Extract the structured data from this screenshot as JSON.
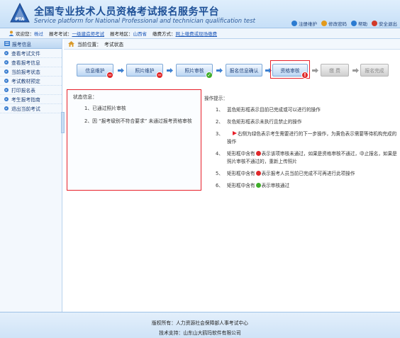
{
  "header": {
    "title": "全国专业技术人员资格考试报名服务平台",
    "subtitle": "Service platform for National Professional and technician qualification test",
    "logo_text": "PTA",
    "links": [
      {
        "label": "注册维护",
        "icon": "register-icon",
        "color": "#2b7bd1"
      },
      {
        "label": "修改密码",
        "icon": "key-icon",
        "color": "#e39a1c"
      },
      {
        "label": "帮助",
        "icon": "help-icon",
        "color": "#2b7bd1"
      },
      {
        "label": "安全退出",
        "icon": "exit-icon",
        "color": "#d23a2a"
      }
    ]
  },
  "infobar": {
    "welcome_label": "欢迎您：",
    "welcome_value": "杨过",
    "exam_label": "报考考试：",
    "exam_value": "一级建造师考试",
    "region_label": "报考地区：",
    "region_value": "山西省",
    "fee_label": "缴费方式：",
    "fee_value": "网上缴费或现场缴费"
  },
  "sidebar": {
    "header": "报考信息",
    "items": [
      {
        "label": "查看考试文件"
      },
      {
        "label": "查看报考信息"
      },
      {
        "label": "当前报考状态"
      },
      {
        "label": "考试教材预定"
      },
      {
        "label": "打印报名表"
      },
      {
        "label": "考生报考指南"
      },
      {
        "label": "退出当前考试"
      }
    ]
  },
  "breadcrumb": {
    "label": "当前位置：",
    "value": "考试状态"
  },
  "steps": [
    {
      "label": "信息维护",
      "state": "fail"
    },
    {
      "label": "照片维护",
      "state": "fail"
    },
    {
      "label": "照片审核",
      "state": "pass"
    },
    {
      "label": "报名信息确认",
      "state": "none"
    },
    {
      "label": "资格审核",
      "state": "warn"
    },
    {
      "label": "缴 费",
      "state": "disabled"
    },
    {
      "label": "报名完成",
      "state": "disabled"
    }
  ],
  "status": {
    "title": "状态信息：",
    "lines": [
      "1、已通过照片审核",
      "2、因 “报考级别不符合要求” 未通过报考资格审核"
    ]
  },
  "tips": {
    "title": "操作提示：",
    "items": [
      {
        "num": "1、",
        "text": "蓝色矩形框表示目前已完成或可以进行的操作"
      },
      {
        "num": "2、",
        "text": "灰色矩形框表示未执行且禁止的操作"
      },
      {
        "num": "3、",
        "text": "右侧为绿色表示考生需要进行的下一步操作，为黄色表示需要等待机构完成的操作"
      },
      {
        "num": "4、",
        "text_a": "矩形框中含有",
        "text_b": "表示该项审核未通过，如果是资格审核不通过，中止报名，如果是照片审核不通过的，重新上传照片"
      },
      {
        "num": "5、",
        "text_a": "矩形框中含有",
        "text_b": "表示报考人员当前已完成不可再进行此项操作"
      },
      {
        "num": "6、",
        "text_a": "矩形框中含有",
        "text_b": "表示审核通过"
      }
    ]
  },
  "footer": {
    "copyright": "版权所有：人力资源社会保障部人事考试中心",
    "support": "技术支持：山东山大鸥玛软件有限公司"
  },
  "colors": {
    "brand": "#1d4f96",
    "highlight": "#e8202a",
    "pass": "#3fae2a",
    "fail": "#e0282a"
  }
}
